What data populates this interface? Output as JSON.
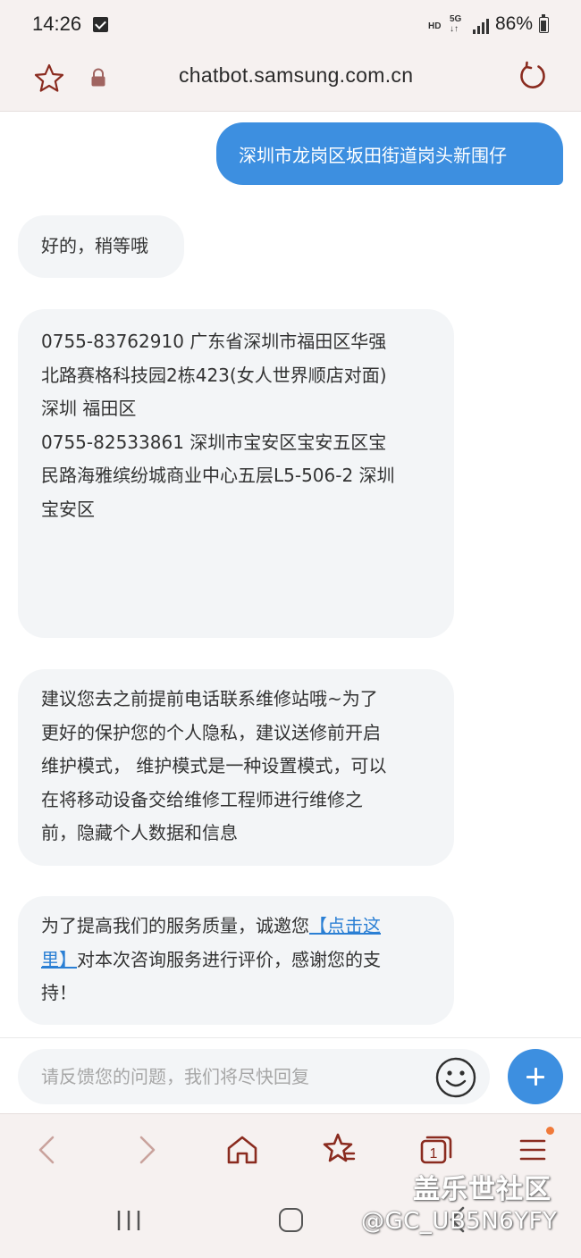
{
  "status_bar": {
    "time": "14:26",
    "hd": "HD",
    "network": "5G",
    "battery": "86%"
  },
  "browser": {
    "url": "chatbot.samsung.com.cn"
  },
  "chat": {
    "user_message": "深圳市龙岗区坂田街道岗头新围仔",
    "bot_ack": "好的，稍等哦",
    "bot_addresses": [
      "0755-83762910 广东省深圳市福田区华强",
      "北路赛格科技园2栋423(女人世界顺店对面)",
      "深圳 福田区",
      "0755-82533861 深圳市宝安区宝安五区宝",
      "民路海雅缤纷城商业中心五层L5-506-2 深圳",
      "宝安区"
    ],
    "bot_advice": [
      "建议您去之前提前电话联系维修站哦~为了",
      "更好的保护您的个人隐私，建议送修前开启",
      "维护模式， 维护模式是一种设置模式，可以",
      "在将移动设备交给维修工程师进行维修之",
      "前，隐藏个人数据和信息"
    ],
    "survey": {
      "line1_text": "为了提高我们的服务质量，诚邀您",
      "line1_link": "【点击这",
      "line2_link": "里】",
      "line2_text": "对本次咨询服务进行评价，感谢您的支",
      "line3_text": "持！"
    }
  },
  "input": {
    "placeholder": "请反馈您的问题，我们将尽快回复",
    "value": ""
  },
  "toolbar": {
    "tabs_count": "1"
  },
  "watermark": {
    "title": "盖乐世社区",
    "handle": "@GC_UB5N6YFY"
  },
  "colors": {
    "accent_blue": "#3d8fe0",
    "browser_icon": "#8a2b1f",
    "bubble_bg": "#f3f5f7",
    "chrome_bg": "#f6f1f0",
    "notify_dot": "#f07a3a"
  }
}
